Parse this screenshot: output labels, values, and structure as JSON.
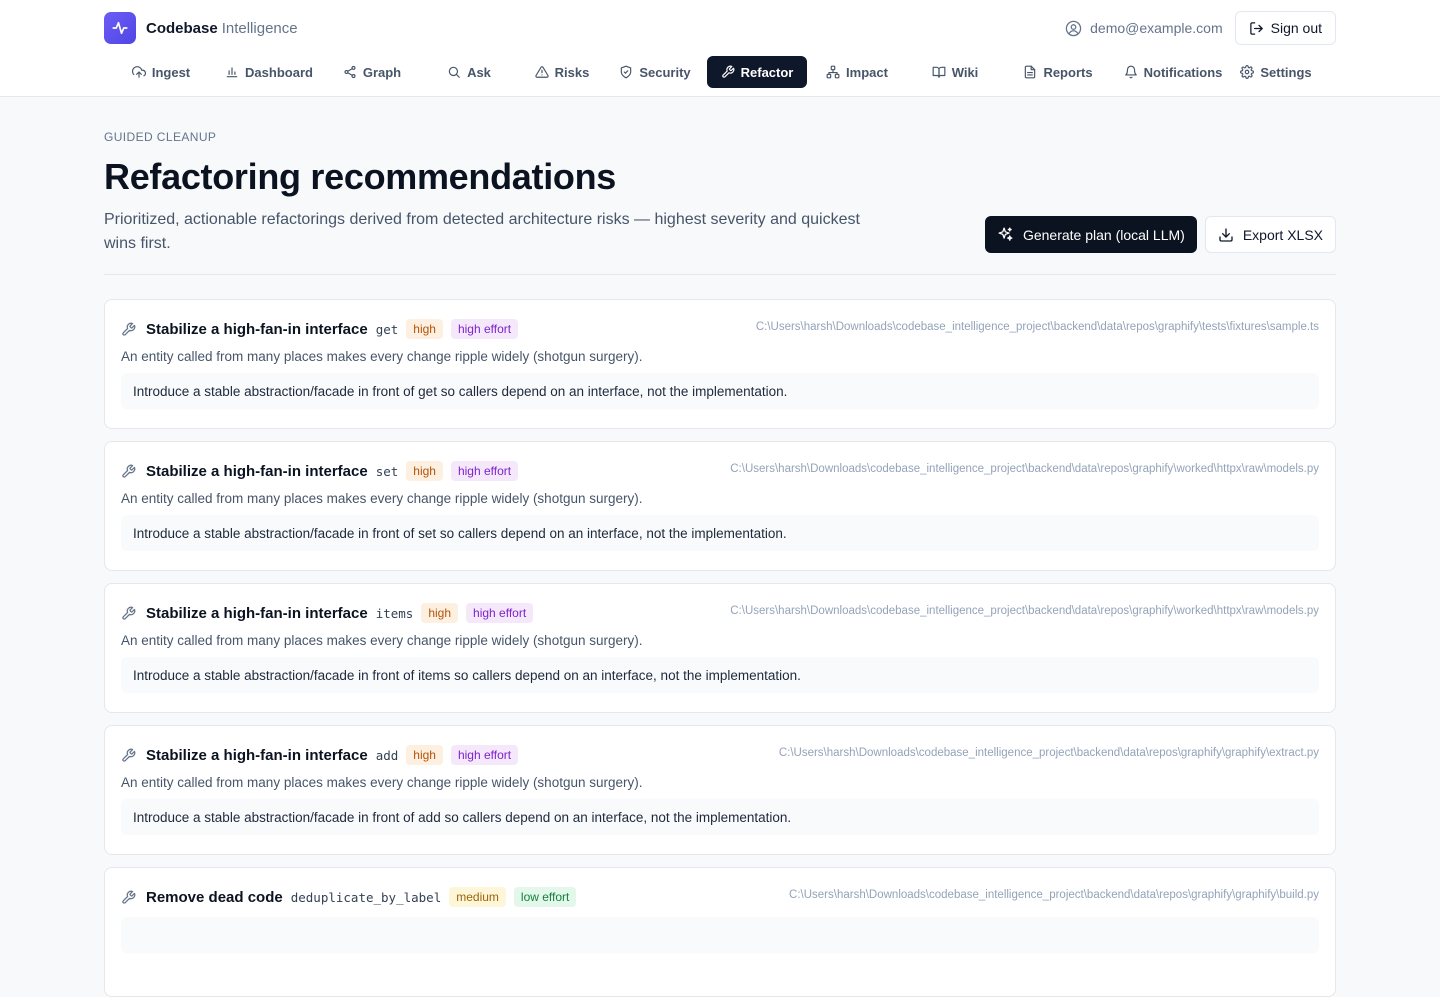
{
  "brand": {
    "name": "Codebase",
    "sub": "Intelligence"
  },
  "user": {
    "email": "demo@example.com",
    "signout_label": "Sign out"
  },
  "nav": [
    {
      "label": "Ingest",
      "icon": "cloud-upload-icon"
    },
    {
      "label": "Dashboard",
      "icon": "bar-chart-icon"
    },
    {
      "label": "Graph",
      "icon": "share-icon"
    },
    {
      "label": "Ask",
      "icon": "search-icon"
    },
    {
      "label": "Risks",
      "icon": "warning-icon"
    },
    {
      "label": "Security",
      "icon": "shield-icon"
    },
    {
      "label": "Refactor",
      "icon": "wrench-icon",
      "active": true
    },
    {
      "label": "Impact",
      "icon": "network-icon"
    },
    {
      "label": "Wiki",
      "icon": "book-icon"
    },
    {
      "label": "Reports",
      "icon": "file-icon"
    },
    {
      "label": "Notifications",
      "icon": "bell-icon"
    },
    {
      "label": "Settings",
      "icon": "gear-icon"
    }
  ],
  "page": {
    "eyebrow": "GUIDED CLEANUP",
    "title": "Refactoring recommendations",
    "subtitle": "Prioritized, actionable refactorings derived from detected architecture risks — highest severity and quickest wins first.",
    "generate_label": "Generate plan (local LLM)",
    "export_label": "Export XLSX"
  },
  "cards": [
    {
      "title": "Stabilize a high-fan-in interface",
      "entity": "get",
      "severity": "high",
      "effort": "high effort",
      "path": "C:\\Users\\harsh\\Downloads\\codebase_intelligence_project\\backend\\data\\repos\\graphify\\tests\\fixtures\\sample.ts",
      "description": "An entity called from many places makes every change ripple widely (shotgun surgery).",
      "recommendation": "Introduce a stable abstraction/facade in front of get so callers depend on an interface, not the implementation."
    },
    {
      "title": "Stabilize a high-fan-in interface",
      "entity": "set",
      "severity": "high",
      "effort": "high effort",
      "path": "C:\\Users\\harsh\\Downloads\\codebase_intelligence_project\\backend\\data\\repos\\graphify\\worked\\httpx\\raw\\models.py",
      "description": "An entity called from many places makes every change ripple widely (shotgun surgery).",
      "recommendation": "Introduce a stable abstraction/facade in front of set so callers depend on an interface, not the implementation."
    },
    {
      "title": "Stabilize a high-fan-in interface",
      "entity": "items",
      "severity": "high",
      "effort": "high effort",
      "path": "C:\\Users\\harsh\\Downloads\\codebase_intelligence_project\\backend\\data\\repos\\graphify\\worked\\httpx\\raw\\models.py",
      "description": "An entity called from many places makes every change ripple widely (shotgun surgery).",
      "recommendation": "Introduce a stable abstraction/facade in front of items so callers depend on an interface, not the implementation."
    },
    {
      "title": "Stabilize a high-fan-in interface",
      "entity": "add",
      "severity": "high",
      "effort": "high effort",
      "path": "C:\\Users\\harsh\\Downloads\\codebase_intelligence_project\\backend\\data\\repos\\graphify\\graphify\\extract.py",
      "description": "An entity called from many places makes every change ripple widely (shotgun surgery).",
      "recommendation": "Introduce a stable abstraction/facade in front of add so callers depend on an interface, not the implementation."
    },
    {
      "title": "Remove dead code",
      "entity": "deduplicate_by_label",
      "severity": "medium",
      "effort": "low effort",
      "path": "C:\\Users\\harsh\\Downloads\\codebase_intelligence_project\\backend\\data\\repos\\graphify\\graphify\\build.py",
      "description": "",
      "recommendation": ""
    }
  ]
}
